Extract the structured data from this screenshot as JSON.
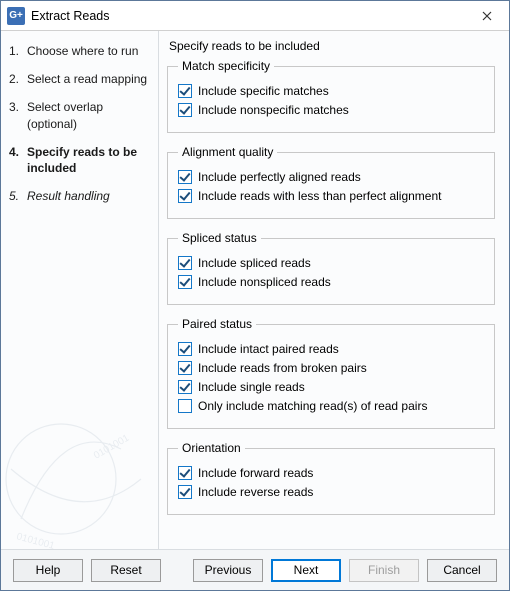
{
  "window": {
    "title": "Extract Reads",
    "icon_text": "G+"
  },
  "sidebar": {
    "steps": [
      {
        "num": "1.",
        "label": "Choose where to run"
      },
      {
        "num": "2.",
        "label": "Select a read mapping"
      },
      {
        "num": "3.",
        "label": "Select overlap (optional)"
      },
      {
        "num": "4.",
        "label": "Specify reads to be included"
      },
      {
        "num": "5.",
        "label": "Result handling"
      }
    ]
  },
  "main": {
    "heading": "Specify reads to be included",
    "groups": [
      {
        "legend": "Match specificity",
        "items": [
          {
            "label": "Include specific matches",
            "checked": true
          },
          {
            "label": "Include nonspecific matches",
            "checked": true
          }
        ]
      },
      {
        "legend": "Alignment quality",
        "items": [
          {
            "label": "Include perfectly aligned reads",
            "checked": true
          },
          {
            "label": "Include reads with less than perfect alignment",
            "checked": true
          }
        ]
      },
      {
        "legend": "Spliced status",
        "items": [
          {
            "label": "Include spliced reads",
            "checked": true
          },
          {
            "label": "Include nonspliced reads",
            "checked": true
          }
        ]
      },
      {
        "legend": "Paired status",
        "items": [
          {
            "label": "Include intact paired reads",
            "checked": true
          },
          {
            "label": "Include reads from broken pairs",
            "checked": true
          },
          {
            "label": "Include single reads",
            "checked": true
          },
          {
            "label": "Only include matching read(s) of read pairs",
            "checked": false
          }
        ]
      },
      {
        "legend": "Orientation",
        "items": [
          {
            "label": "Include forward reads",
            "checked": true
          },
          {
            "label": "Include reverse reads",
            "checked": true
          }
        ]
      }
    ]
  },
  "footer": {
    "help": "Help",
    "reset": "Reset",
    "previous": "Previous",
    "next": "Next",
    "finish": "Finish",
    "cancel": "Cancel"
  }
}
